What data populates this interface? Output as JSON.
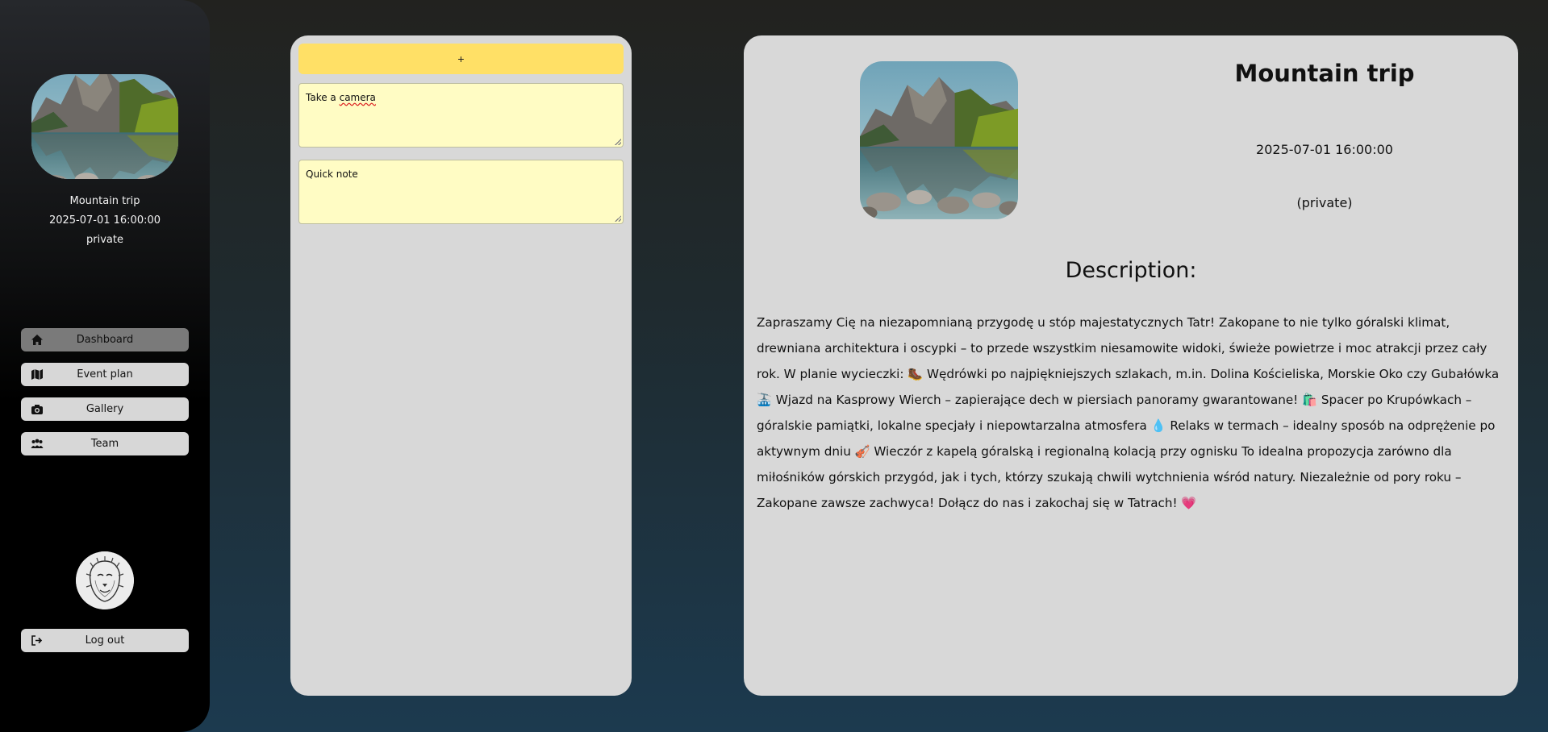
{
  "sidebar": {
    "event_title": "Mountain trip",
    "event_date": "2025-07-01 16:00:00",
    "event_privacy": "private",
    "nav": [
      {
        "label": "Dashboard",
        "icon": "home-icon",
        "active": true
      },
      {
        "label": "Event plan",
        "icon": "map-icon",
        "active": false
      },
      {
        "label": "Gallery",
        "icon": "camera-icon",
        "active": false
      },
      {
        "label": "Team",
        "icon": "users-icon",
        "active": false
      }
    ],
    "logout_label": "Log out",
    "logout_icon": "logout-icon"
  },
  "notes": {
    "add_label": "+",
    "items": [
      {
        "text_before": "Take a ",
        "text_misspelled": "camera"
      },
      {
        "text": "Quick note"
      }
    ]
  },
  "event": {
    "title": "Mountain trip",
    "date": "2025-07-01 16:00:00",
    "privacy": "(private)",
    "description_heading": "Description:",
    "description": "Zapraszamy Cię na niezapomnianą przygodę u stóp majestatycznych Tatr! Zakopane to nie tylko góralski klimat, drewniana architektura i oscypki – to przede wszystkim niesamowite widoki, świeże powietrze i moc atrakcji przez cały rok. W planie wycieczki: 🥾 Wędrówki po najpiękniejszych szlakach, m.in. Dolina Kościeliska, Morskie Oko czy Gubałówka 🚠 Wjazd na Kasprowy Wierch – zapierające dech w piersiach panoramy gwarantowane! 🛍️ Spacer po Krupówkach – góralskie pamiątki, lokalne specjały i niepowtarzalna atmosfera 💧 Relaks w termach – idealny sposób na odprężenie po aktywnym dniu 🎻 Wieczór z kapelą góralską i regionalną kolacją przy ognisku To idealna propozycja zarówno dla miłośników górskich przygód, jak i tych, którzy szukają chwili wytchnienia wśród natury. Niezależnie od pory roku – Zakopane zawsze zachwyca! Dołącz do nas i zakochaj się w Tatrach! 💗"
  },
  "colors": {
    "add_button": "#ffe066",
    "note_bg": "#fffcc4",
    "panel_bg": "#d8d8d8",
    "nav_active": "#7a7a7a"
  }
}
